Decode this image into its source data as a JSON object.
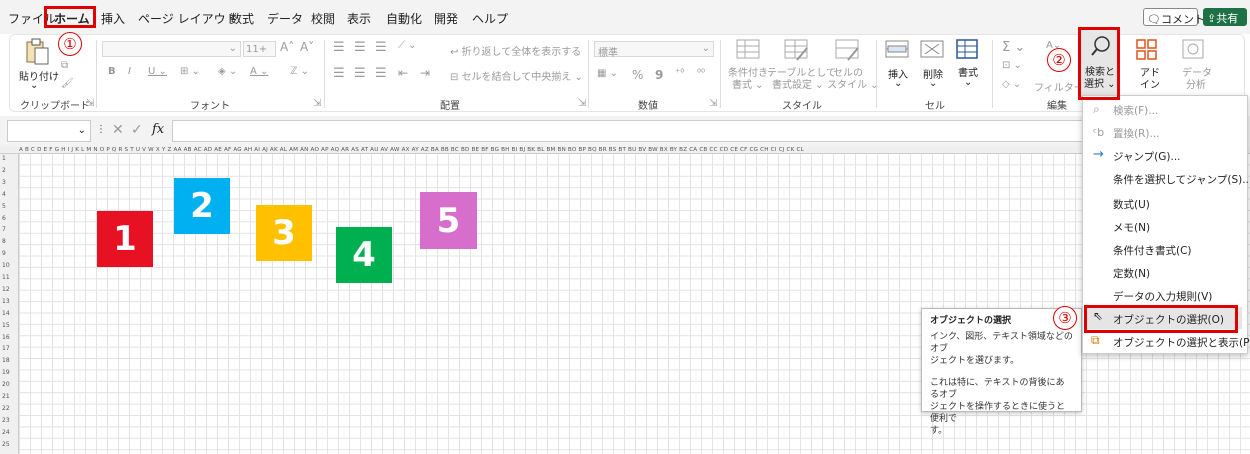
{
  "tabs": [
    "ファイル",
    "ホーム",
    "挿入",
    "ページ レイアウト",
    "数式",
    "データ",
    "校閲",
    "表示",
    "自動化",
    "開発",
    "ヘルプ"
  ],
  "comment_label": "コメント",
  "share_label": "共有",
  "ribbon": {
    "paste": "貼り付け",
    "clipboard": "クリップボード",
    "font_size": "11+",
    "font_group": "フォント",
    "wrap_text": "折り返して全体を表示する",
    "merge_center": "セルを結合して中央揃え",
    "align_group": "配置",
    "number_format": "標準",
    "number_group": "数値",
    "cond_format_1": "条件付き",
    "cond_format_2": "書式",
    "table_format_1": "テーブルとして",
    "table_format_2": "書式設定",
    "cell_style_1": "セルの",
    "cell_style_2": "スタイル",
    "style_group": "スタイル",
    "insert": "挿入",
    "delete": "削除",
    "format": "書式",
    "cell_group": "セル",
    "filter": "フィルター",
    "edit_group": "編集",
    "find_select_1": "検索と",
    "find_select_2": "選択",
    "addin_1": "アド",
    "addin_2": "イン",
    "analyze_1": "データ",
    "analyze_2": "分析"
  },
  "fx": "fx",
  "columns": "A B C D E F G H I J K L M N O P Q R S T U V W X Y Z AA AB AC AD AE AF AG AH AI AJ AK AL AM AN AO AP AQ AR AS AT AU AV AW AX AY AZ BA BB BC BD BE BF BG BH BI BJ BK BL BM BN BO BP BQ BR BS BT BU BV BW BX BY BZ CA CB CC CD CE CF CG CH CI CJ CK CL",
  "rows": [
    "1",
    "2",
    "3",
    "4",
    "5",
    "6",
    "7",
    "8",
    "9",
    "10",
    "11",
    "12",
    "13",
    "14",
    "15",
    "16",
    "17",
    "18",
    "19",
    "20",
    "21",
    "22",
    "23",
    "24",
    "25"
  ],
  "shapes": [
    {
      "label": "1",
      "color": "#e81123"
    },
    {
      "label": "2",
      "color": "#00b0f0"
    },
    {
      "label": "3",
      "color": "#ffc000"
    },
    {
      "label": "4",
      "color": "#00b050"
    },
    {
      "label": "5",
      "color": "#d86ecc"
    }
  ],
  "menu": {
    "find": "検索(F)...",
    "replace": "置換(R)...",
    "goto": "ジャンプ(G)...",
    "goto_special": "条件を選択してジャンプ(S)...",
    "formulas": "数式(U)",
    "notes": "メモ(N)",
    "cond_formatting": "条件付き書式(C)",
    "constants": "定数(N)",
    "data_validation": "データの入力規則(V)",
    "select_objects": "オブジェクトの選択(O)",
    "selection_pane": "オブジェクトの選択と表示(P)..."
  },
  "tooltip": {
    "title": "オブジェクトの選択",
    "line1": "インク、図形、テキスト領域などのオブ",
    "line2": "ジェクトを選びます。",
    "line3": "これは特に、テキストの背後にあるオブ",
    "line4": "ジェクトを操作するときに使うと便利で",
    "line5": "す。"
  },
  "steps": [
    "①",
    "②",
    "③"
  ],
  "accent": "#e00000"
}
